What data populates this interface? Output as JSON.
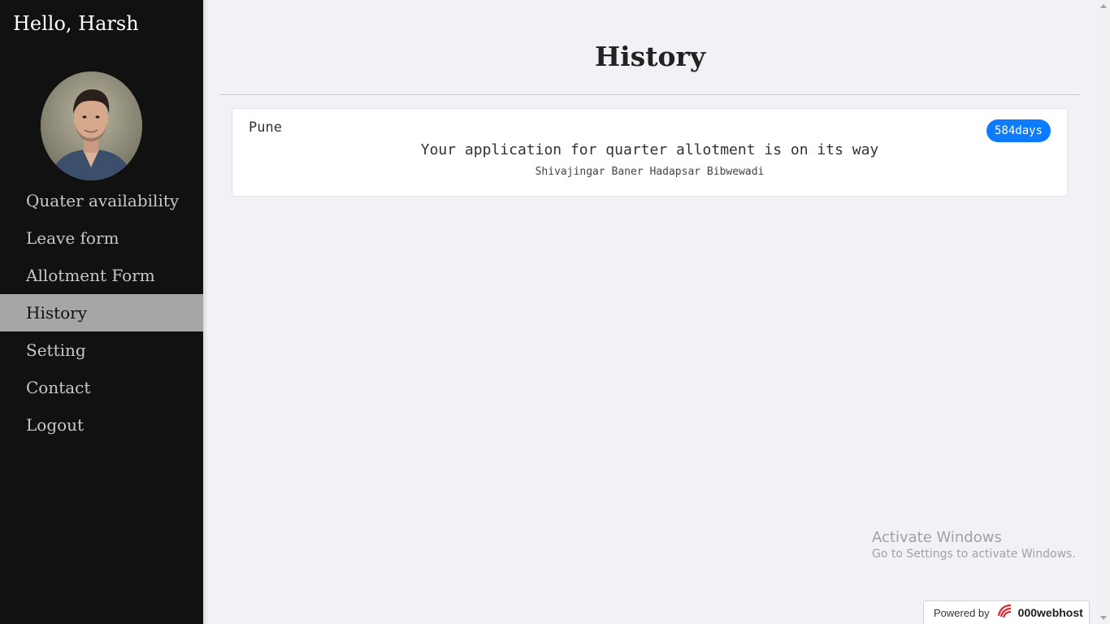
{
  "sidebar": {
    "greeting": "Hello, Harsh",
    "avatar_icon": "user-avatar-photo",
    "items": [
      {
        "label": "Quater availability",
        "active": false
      },
      {
        "label": "Leave form",
        "active": false
      },
      {
        "label": "Allotment Form",
        "active": false
      },
      {
        "label": "History",
        "active": true
      },
      {
        "label": "Setting",
        "active": false
      },
      {
        "label": "Contact",
        "active": false
      },
      {
        "label": "Logout",
        "active": false
      }
    ]
  },
  "main": {
    "title": "History",
    "card": {
      "city": "Pune",
      "badge": "584days",
      "message": "Your application for quarter allotment is on its way",
      "locations": "Shivajingar Baner Hadapsar Bibwewadi"
    }
  },
  "overlay": {
    "activate_title": "Activate Windows",
    "activate_subtitle": "Go to Settings to activate Windows."
  },
  "footer": {
    "powered_label": "Powered by",
    "powered_brand": "000webhost",
    "brand_icon": "000webhost-logo-icon"
  },
  "colors": {
    "sidebar_bg": "#111111",
    "active_item_bg": "#a6a6a6",
    "badge": "#0d7bff",
    "page_bg": "#f0f2f6"
  }
}
